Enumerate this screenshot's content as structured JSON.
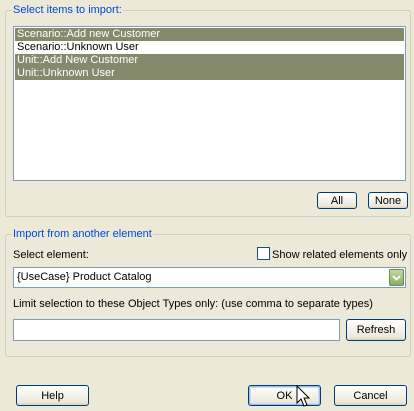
{
  "import_items": {
    "title": "Select items to import:",
    "items": [
      {
        "label": "Scenario::Add new Customer",
        "selected": true
      },
      {
        "label": "Scenario::Unknown User",
        "selected": false
      },
      {
        "label": "Unit::Add New Customer",
        "selected": true
      },
      {
        "label": "Unit::Unknown User",
        "selected": true
      }
    ],
    "all_label": "All",
    "none_label": "None"
  },
  "another_element": {
    "title": "Import from another element",
    "select_element_label": "Select element:",
    "show_related_label": "Show related elements only",
    "show_related_checked": false,
    "selected_element": "{UseCase} Product Catalog",
    "limit_label": "Limit selection to these Object Types only: (use comma to separate types)",
    "types_value": "",
    "refresh_label": "Refresh"
  },
  "dialog_buttons": {
    "help": "Help",
    "ok": "OK",
    "cancel": "Cancel"
  },
  "icons": {
    "dropdown": "chevron-down-icon",
    "cursor": "mouse-pointer-icon"
  }
}
